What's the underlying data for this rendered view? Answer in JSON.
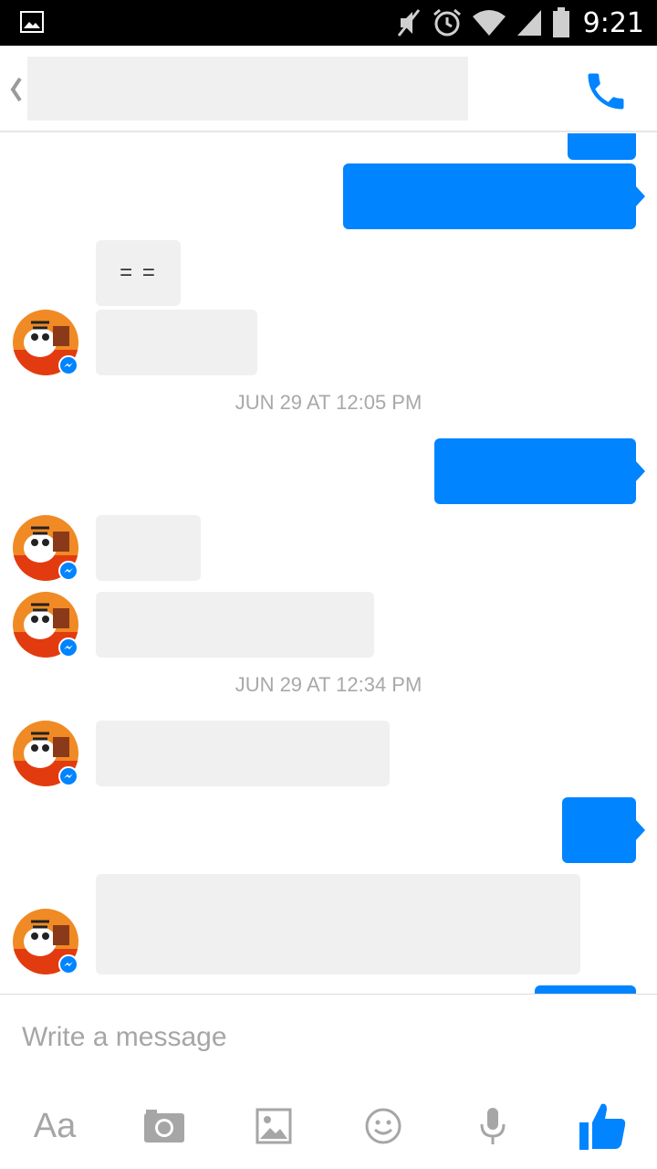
{
  "status_bar": {
    "time": "9:21",
    "icons": [
      "gallery-icon",
      "mute-icon",
      "alarm-icon",
      "wifi-icon",
      "signal-icon",
      "battery-icon"
    ]
  },
  "header": {
    "back_icon": "chevron-left-icon",
    "call_icon": "phone-icon",
    "accent_color": "#0084ff"
  },
  "conversation": {
    "incoming_text_1": "= =",
    "timestamps": [
      "JUN 29 AT 12:05 PM",
      "JUN 29 AT 12:34 PM"
    ],
    "outgoing_bubble_color": "#0084ff",
    "incoming_bubble_color": "#f0f0f0"
  },
  "composer": {
    "placeholder": "Write a message",
    "text_button_label": "Aa",
    "tools": [
      "camera-icon",
      "image-icon",
      "emoji-icon",
      "microphone-icon",
      "thumbs-up-icon"
    ]
  }
}
